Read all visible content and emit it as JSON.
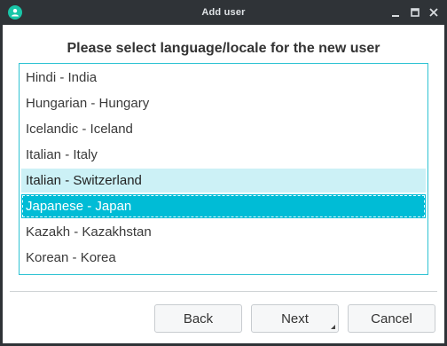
{
  "window": {
    "title": "Add user",
    "controls": [
      "minimize-icon",
      "maximize-icon",
      "close-icon"
    ]
  },
  "prompt": "Please select language/locale for the new user",
  "locales": [
    {
      "label": "Hindi - India",
      "state": "normal"
    },
    {
      "label": "Hungarian - Hungary",
      "state": "normal"
    },
    {
      "label": "Icelandic - Iceland",
      "state": "normal"
    },
    {
      "label": "Italian - Italy",
      "state": "normal"
    },
    {
      "label": "Italian - Switzerland",
      "state": "hover"
    },
    {
      "label": "Japanese - Japan",
      "state": "selected"
    },
    {
      "label": "Kazakh - Kazakhstan",
      "state": "normal"
    },
    {
      "label": "Korean - Korea",
      "state": "normal"
    }
  ],
  "buttons": {
    "back": "Back",
    "next": "Next",
    "cancel": "Cancel"
  },
  "colors": {
    "accent": "#00bcd6",
    "hover": "#ccf1f6",
    "app_icon": "#19c6a8"
  }
}
